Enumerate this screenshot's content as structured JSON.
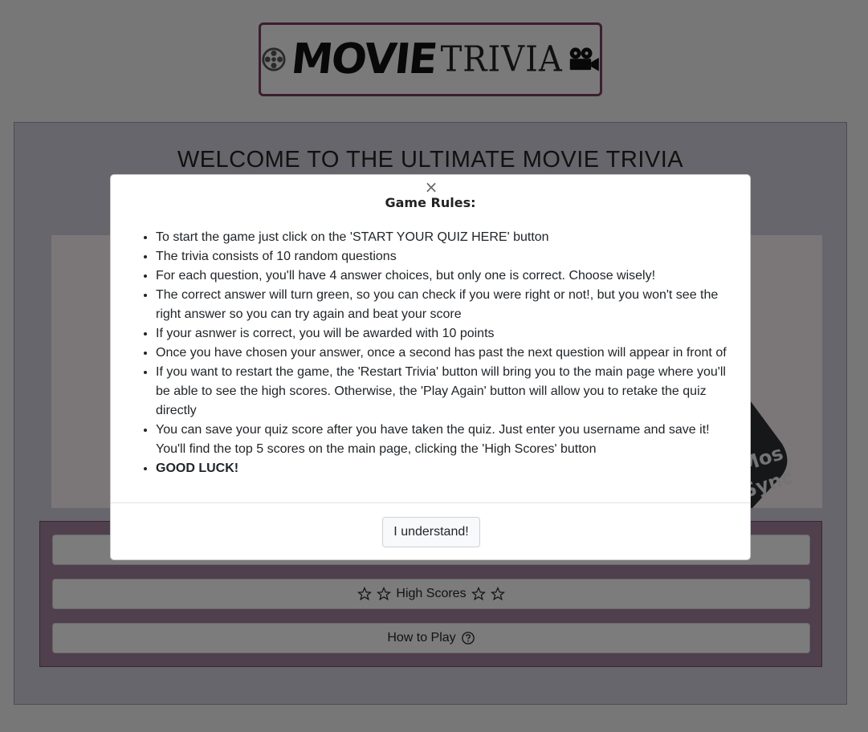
{
  "header": {
    "logo_movie": "MOVIE",
    "logo_trivia": "TRIVIA"
  },
  "main": {
    "welcome_title": "WELCOME TO THE ULTIMATE MOVIE TRIVIA",
    "hero_text_1": "Mos",
    "hero_text_2": "Sync",
    "buttons": {
      "high_scores": "High Scores",
      "how_to_play": "How to Play"
    }
  },
  "modal": {
    "close_glyph": "×",
    "title": "Game Rules:",
    "rules": [
      "To start the game just click on the 'START YOUR QUIZ HERE' button",
      "The trivia consists of 10 random questions",
      "For each question, you'll have 4 answer choices, but only one is correct. Choose wisely!",
      "The correct answer will turn green, so you can check if you were right or not!, but you won't see the right answer so you can try again and beat your score",
      "If your asnwer is correct, you will be awarded with 10 points",
      "Once you have chosen your answer, once a second has past the next question will appear in front of",
      "If you want to restart the game, the 'Restart Trivia' button will bring you to the main page where you'll be able to see the high scores. Otherwise, the 'Play Again' button will allow you to retake the quiz directly",
      "You can save your quiz score after you have taken the quiz. Just enter you username and save it! You'll find the top 5 scores on the main page, clicking the 'High Scores' button",
      "GOOD LUCK!"
    ],
    "confirm_label": "I understand!"
  },
  "colors": {
    "logo_border": "#7a3d5e",
    "panel_bg": "#a07f98",
    "backdrop": "rgba(0,0,0,0.5)"
  }
}
